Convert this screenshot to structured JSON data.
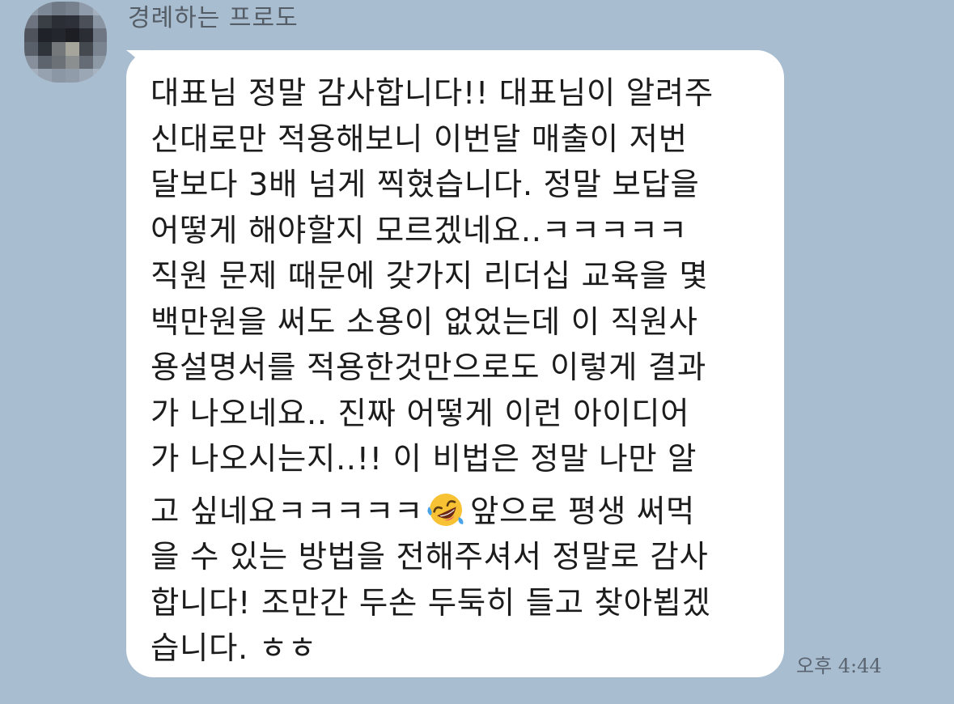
{
  "sender": {
    "name": "경례하는 프로도",
    "avatar_icon": "blurred-profile-avatar-icon"
  },
  "message": {
    "lines": [
      "대표님 정말 감사합니다!! 대표님이 알려주",
      "신대로만 적용해보니 이번달 매출이 저번",
      "달보다 3배 넘게 찍혔습니다. 정말 보답을",
      "어떻게 해야할지 모르겠네요..ㅋㅋㅋㅋㅋ",
      "직원 문제 때문에 갖가지 리더십 교육을 몇",
      "백만원을 써도 소용이 없었는데 이 직원사",
      "용설명서를 적용한것만으로도 이렇게 결과",
      "가 나오네요.. 진짜 어떻게 이런 아이디어",
      "가 나오시는지..!! 이 비법은 정말 나만 알"
    ],
    "emoji_line_before": "고 싶네요ㅋㅋㅋㅋㅋ",
    "emoji": "rolling-on-the-floor-laughing-emoji",
    "emoji_line_after": "앞으로 평생 써먹",
    "lines_after": [
      "을 수 있는 방법을 전해주셔서 정말로 감사",
      "합니다! 조만간 두손 두둑히 들고 찾아뵙겠",
      "습니다. ㅎㅎ"
    ],
    "timestamp": "오후 4:44"
  },
  "colors": {
    "background": "#a9bdd0",
    "bubble": "#ffffff",
    "text": "#1c1c1c",
    "name": "#545c66",
    "timestamp": "#5a6470"
  }
}
